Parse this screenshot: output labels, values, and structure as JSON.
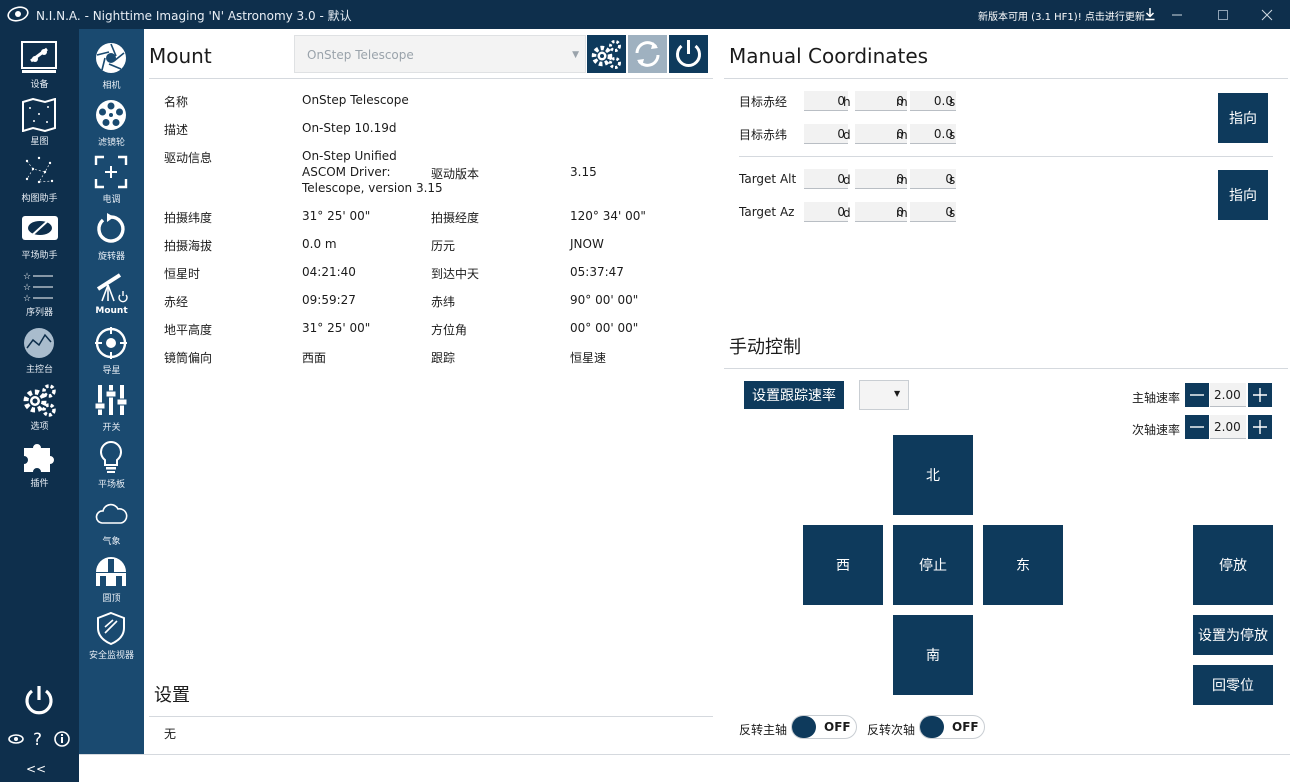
{
  "titlebar": {
    "title": "N.I.N.A. - Nighttime Imaging 'N' Astronomy 3.0  -  默认",
    "update": "新版本可用 (3.1 HF1)! 点击进行更新"
  },
  "nav_main": [
    {
      "label": "设备",
      "icon": "telescope-equipment-icon"
    },
    {
      "label": "星图",
      "icon": "sky-atlas-icon"
    },
    {
      "label": "构图助手",
      "icon": "framing-icon"
    },
    {
      "label": "平场助手",
      "icon": "flat-wizard-icon"
    },
    {
      "label": "序列器",
      "icon": "sequencer-icon"
    },
    {
      "label": "主控台",
      "icon": "imaging-icon"
    },
    {
      "label": "选项",
      "icon": "gear-icon"
    },
    {
      "label": "插件",
      "icon": "puzzle-icon"
    }
  ],
  "nav_equipment": [
    {
      "label": "相机",
      "icon": "camera-icon"
    },
    {
      "label": "滤镜轮",
      "icon": "filter-wheel-icon"
    },
    {
      "label": "电调",
      "icon": "focuser-icon"
    },
    {
      "label": "旋转器",
      "icon": "rotator-icon"
    },
    {
      "label": "Mount",
      "icon": "mount-icon"
    },
    {
      "label": "导星",
      "icon": "guider-icon"
    },
    {
      "label": "开关",
      "icon": "switch-icon"
    },
    {
      "label": "平场板",
      "icon": "flat-panel-icon"
    },
    {
      "label": "气象",
      "icon": "weather-icon"
    },
    {
      "label": "圆顶",
      "icon": "dome-icon"
    },
    {
      "label": "安全监视器",
      "icon": "safety-monitor-icon"
    }
  ],
  "mount": {
    "title": "Mount",
    "device": "OnStep Telescope",
    "info": {
      "name_label": "名称",
      "name": "OnStep Telescope",
      "desc_label": "描述",
      "desc": "On-Step 10.19d",
      "driver_info_label": "驱动信息",
      "driver_info_line1": "On-Step Unified",
      "driver_info_line2": "ASCOM Driver:",
      "driver_info_line3": "Telescope, version 3.15",
      "driver_version_label": "驱动版本",
      "driver_version": "3.15",
      "site_lat_label": "拍摄纬度",
      "site_lat": "31° 25' 00\"",
      "site_lon_label": "拍摄经度",
      "site_lon": "120° 34' 00\"",
      "elevation_label": "拍摄海拔",
      "elevation": "0.0 m",
      "epoch_label": "历元",
      "epoch": "JNOW",
      "sidereal_label": "恒星时",
      "sidereal": "04:21:40",
      "meridian_label": "到达中天",
      "meridian": "05:37:47",
      "ra_label": "赤经",
      "ra": "09:59:27",
      "dec_label": "赤纬",
      "dec": "90° 00' 00\"",
      "alt_label": "地平高度",
      "alt": "31° 25' 00\"",
      "az_label": "方位角",
      "az": "00° 00' 00\"",
      "pier_label": "镜筒偏向",
      "pier": "西面",
      "tracking_label": "跟踪",
      "tracking": "恒星速"
    }
  },
  "settings": {
    "title": "设置",
    "value": "无"
  },
  "manual_coords": {
    "title": "Manual Coordinates",
    "ra_label": "目标赤经",
    "ra_h": "0",
    "ra_m": "0",
    "ra_s": "0.0",
    "dec_label": "目标赤纬",
    "dec_d": "0",
    "dec_m": "0",
    "dec_s": "0.0",
    "alt_label": "Target Alt",
    "alt_d": "0",
    "alt_m": "0",
    "alt_s": "0",
    "az_label": "Target Az",
    "az_d": "0",
    "az_m": "0",
    "az_s": "0",
    "unit_h": "h",
    "unit_d": "d",
    "unit_m": "m",
    "unit_s": "s",
    "slew_label": "指向"
  },
  "manual_control": {
    "title": "手动控制",
    "set_tracking_label": "设置跟踪速率",
    "primary_rate_label": "主轴速率",
    "primary_rate": "2.00",
    "secondary_rate_label": "次轴速率",
    "secondary_rate": "2.00",
    "north": "北",
    "south": "南",
    "west": "西",
    "east": "东",
    "stop": "停止",
    "park": "停放",
    "set_park": "设置为停放",
    "home": "回零位",
    "reverse_primary_label": "反转主轴",
    "reverse_primary": "OFF",
    "reverse_secondary_label": "反转次轴",
    "reverse_secondary": "OFF"
  },
  "colors": {
    "nav_dark": "#0e2f4c",
    "nav_mid": "#1a4a70",
    "button": "#0e3a5c",
    "button_disabled": "#9fb1c0"
  }
}
